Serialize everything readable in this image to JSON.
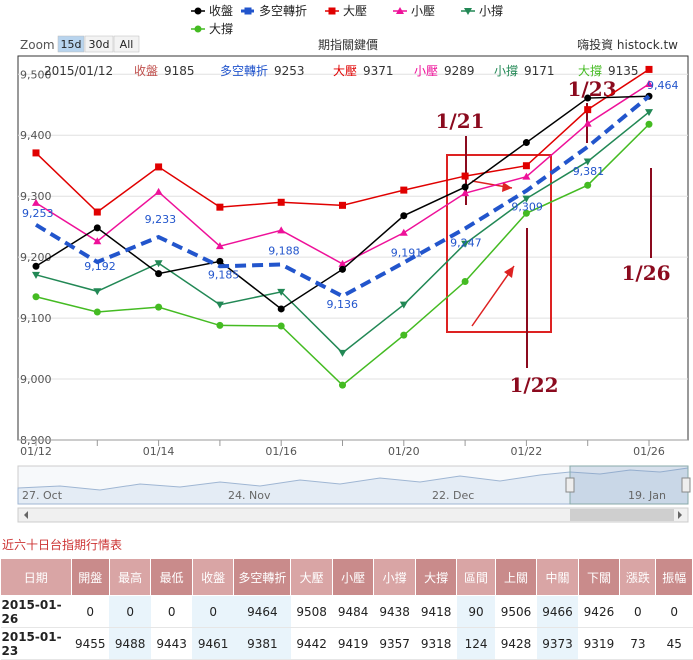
{
  "legend": {
    "items": [
      {
        "name": "收盤",
        "color": "#000000",
        "marker": "circle",
        "dash": false
      },
      {
        "name": "多空轉折",
        "color": "#2255cc",
        "marker": "square",
        "dash": true
      },
      {
        "name": "大壓",
        "color": "#e00000",
        "marker": "square",
        "dash": false
      },
      {
        "name": "小壓",
        "color": "#ee1199",
        "marker": "triangle",
        "dash": false
      },
      {
        "name": "小撐",
        "color": "#228855",
        "marker": "triangle-down",
        "dash": false
      },
      {
        "name": "大撐",
        "color": "#44bb22",
        "marker": "circle",
        "dash": false
      }
    ]
  },
  "zoom": {
    "label": "Zoom",
    "buttons": [
      "15d",
      "30d",
      "All"
    ],
    "active": "15d"
  },
  "chart_title": "期指關鍵價",
  "brand": "嗨投資 histock.tw",
  "infobar": {
    "date": "2015/01/12",
    "values": [
      {
        "label": "收盤",
        "value": "9185",
        "color": "#c0504d"
      },
      {
        "label": "多空轉折",
        "value": "9253",
        "color": "#2255cc"
      },
      {
        "label": "大壓",
        "value": "9371",
        "color": "#e00000"
      },
      {
        "label": "小壓",
        "value": "9289",
        "color": "#ee1199"
      },
      {
        "label": "小撐",
        "value": "9171",
        "color": "#228855"
      },
      {
        "label": "大撐",
        "value": "9135",
        "color": "#44bb22"
      }
    ]
  },
  "chart_data": {
    "type": "line",
    "x": [
      "01/12",
      "01/13",
      "01/14",
      "01/15",
      "01/16",
      "01/19",
      "01/20",
      "01/21",
      "01/22",
      "01/23",
      "01/26"
    ],
    "x_tick_labels": [
      "01/12",
      "01/14",
      "01/16",
      "01/20",
      "01/22",
      "01/26"
    ],
    "y_ticks": [
      8900,
      9000,
      9100,
      9200,
      9300,
      9400,
      9500
    ],
    "y_tick_labels": [
      "8,900",
      "9,000",
      "9,100",
      "9,200",
      "9,300",
      "9,400",
      "9,500"
    ],
    "ylim": [
      8900,
      9530
    ],
    "grid": true,
    "series": [
      {
        "name": "收盤",
        "values": [
          9185,
          9248,
          9173,
          9193,
          9115,
          9180,
          9268,
          9315,
          9388,
          9461,
          9464
        ]
      },
      {
        "name": "多空轉折",
        "values": [
          9253,
          9192,
          9233,
          9185,
          9188,
          9136,
          9191,
          9247,
          9309,
          9381,
          9464
        ]
      },
      {
        "name": "大壓",
        "values": [
          9371,
          9274,
          9348,
          9282,
          9290,
          9285,
          9310,
          9333,
          9350,
          9442,
          9508
        ]
      },
      {
        "name": "小壓",
        "values": [
          9289,
          9226,
          9307,
          9218,
          9244,
          9189,
          9240,
          9305,
          9332,
          9419,
          9484
        ]
      },
      {
        "name": "小撐",
        "values": [
          9171,
          9144,
          9190,
          9122,
          9143,
          9043,
          9122,
          9222,
          9296,
          9357,
          9438
        ]
      },
      {
        "name": "大撐",
        "values": [
          9135,
          9110,
          9118,
          9088,
          9087,
          8990,
          9072,
          9160,
          9272,
          9318,
          9418
        ]
      }
    ],
    "data_labels": [
      {
        "series": "多空轉折",
        "index": 0,
        "text": "9,253"
      },
      {
        "series": "多空轉折",
        "index": 1,
        "text": "9,192"
      },
      {
        "series": "多空轉折",
        "index": 2,
        "text": "9,233"
      },
      {
        "series": "多空轉折",
        "index": 3,
        "text": "9,185"
      },
      {
        "series": "多空轉折",
        "index": 4,
        "text": "9,188"
      },
      {
        "series": "多空轉折",
        "index": 5,
        "text": "9,136"
      },
      {
        "series": "多空轉折",
        "index": 6,
        "text": "9,191"
      },
      {
        "series": "多空轉折",
        "index": 7,
        "text": "9,247"
      },
      {
        "series": "多空轉折",
        "index": 8,
        "text": "9,309"
      },
      {
        "series": "多空轉折",
        "index": 9,
        "text": "9,381"
      },
      {
        "series": "多空轉折",
        "index": 10,
        "text": "9,464"
      }
    ],
    "annotations": [
      {
        "text": "1/21"
      },
      {
        "text": "1/23"
      },
      {
        "text": "1/22"
      },
      {
        "text": "1/26"
      }
    ]
  },
  "navigator": {
    "labels": [
      "27. Oct",
      "24. Nov",
      "22. Dec",
      "19. Jan"
    ]
  },
  "table": {
    "title": "近六十日台指期行情表",
    "headers": [
      "日期",
      "開盤",
      "最高",
      "最低",
      "收盤",
      "多空轉折",
      "大壓",
      "小壓",
      "小撐",
      "大撐",
      "區間",
      "上關",
      "中關",
      "下關",
      "漲跌",
      "振幅"
    ],
    "rows": [
      [
        "2015-01-26",
        "0",
        "0",
        "0",
        "0",
        "9464",
        "9508",
        "9484",
        "9438",
        "9418",
        "90",
        "9506",
        "9466",
        "9426",
        "0",
        "0"
      ],
      [
        "2015-01-23",
        "9455",
        "9488",
        "9443",
        "9461",
        "9381",
        "9442",
        "9419",
        "9357",
        "9318",
        "124",
        "9428",
        "9373",
        "9319",
        "73",
        "45"
      ]
    ]
  }
}
